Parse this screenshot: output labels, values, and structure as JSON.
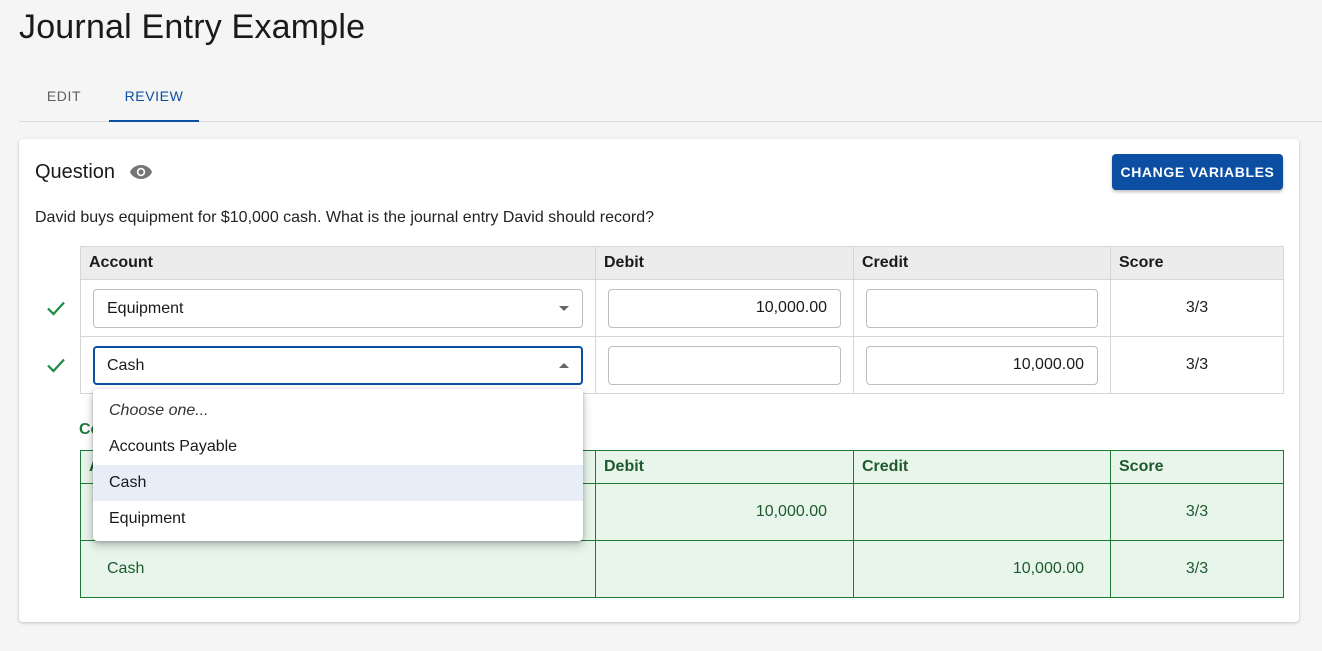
{
  "page": {
    "title": "Journal Entry Example"
  },
  "tabs": [
    {
      "label": "EDIT",
      "active": false
    },
    {
      "label": "REVIEW",
      "active": true
    }
  ],
  "question": {
    "heading": "Question",
    "icon": "eye-icon",
    "change_button": "CHANGE VARIABLES",
    "text": "David buys equipment for $10,000 cash. What is the journal entry David should record?"
  },
  "entry_table": {
    "headers": {
      "account": "Account",
      "debit": "Debit",
      "credit": "Credit",
      "score": "Score"
    },
    "rows": [
      {
        "status_icon": "check-icon",
        "account": "Equipment",
        "debit": "10,000.00",
        "credit": "",
        "score": "3/3"
      },
      {
        "status_icon": "check-icon",
        "account": "Cash",
        "debit": "",
        "credit": "10,000.00",
        "score": "3/3"
      }
    ]
  },
  "dropdown": {
    "options": [
      "Choose one...",
      "Accounts Payable",
      "Cash",
      "Equipment"
    ],
    "selected": "Cash"
  },
  "correct_answer": {
    "label_visible": "Co",
    "headers": {
      "account": "A",
      "debit": "Debit",
      "credit": "Credit",
      "score": "Score"
    },
    "rows": [
      {
        "account": "",
        "debit": "10,000.00",
        "credit": "",
        "score": "3/3"
      },
      {
        "account": "Cash",
        "debit": "",
        "credit": "10,000.00",
        "score": "3/3"
      }
    ]
  },
  "colors": {
    "primary": "#0b4ea2",
    "success": "#1f7a3a",
    "success_bg": "#e8f5eb"
  }
}
